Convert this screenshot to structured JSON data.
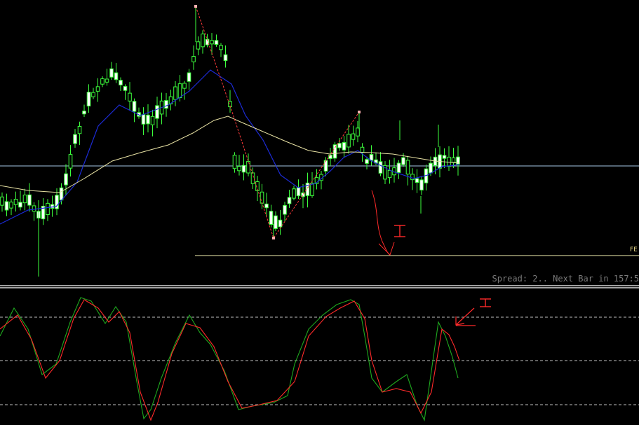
{
  "status_text": "Spread: 2.. Next Bar in 157:5",
  "level_tag": "FE",
  "annotation_mark": "I",
  "colors": {
    "background": "#000000",
    "candle": "#3cff3c",
    "candle_body_up": "#000000",
    "candle_body_down": "#ffffff",
    "ma_fast": "#1c2bd6",
    "ma_slow": "#e8e2a4",
    "zigzag": "#ff3a3a",
    "hline_price": "#a6c8e6",
    "hline_level": "#f2efb0",
    "stoch_main": "#1ea81e",
    "stoch_signal": "#ff2a2a",
    "stoch_levels": "#bfbfbf",
    "annotation": "#ff2a2a"
  },
  "chart_data": [
    {
      "type": "candlestick",
      "series": [
        {
          "name": "",
          "values": []
        }
      ],
      "grid": false
    },
    {
      "type": "line",
      "series": [
        {
          "name": "",
          "values": []
        }
      ],
      "grid": false
    }
  ]
}
